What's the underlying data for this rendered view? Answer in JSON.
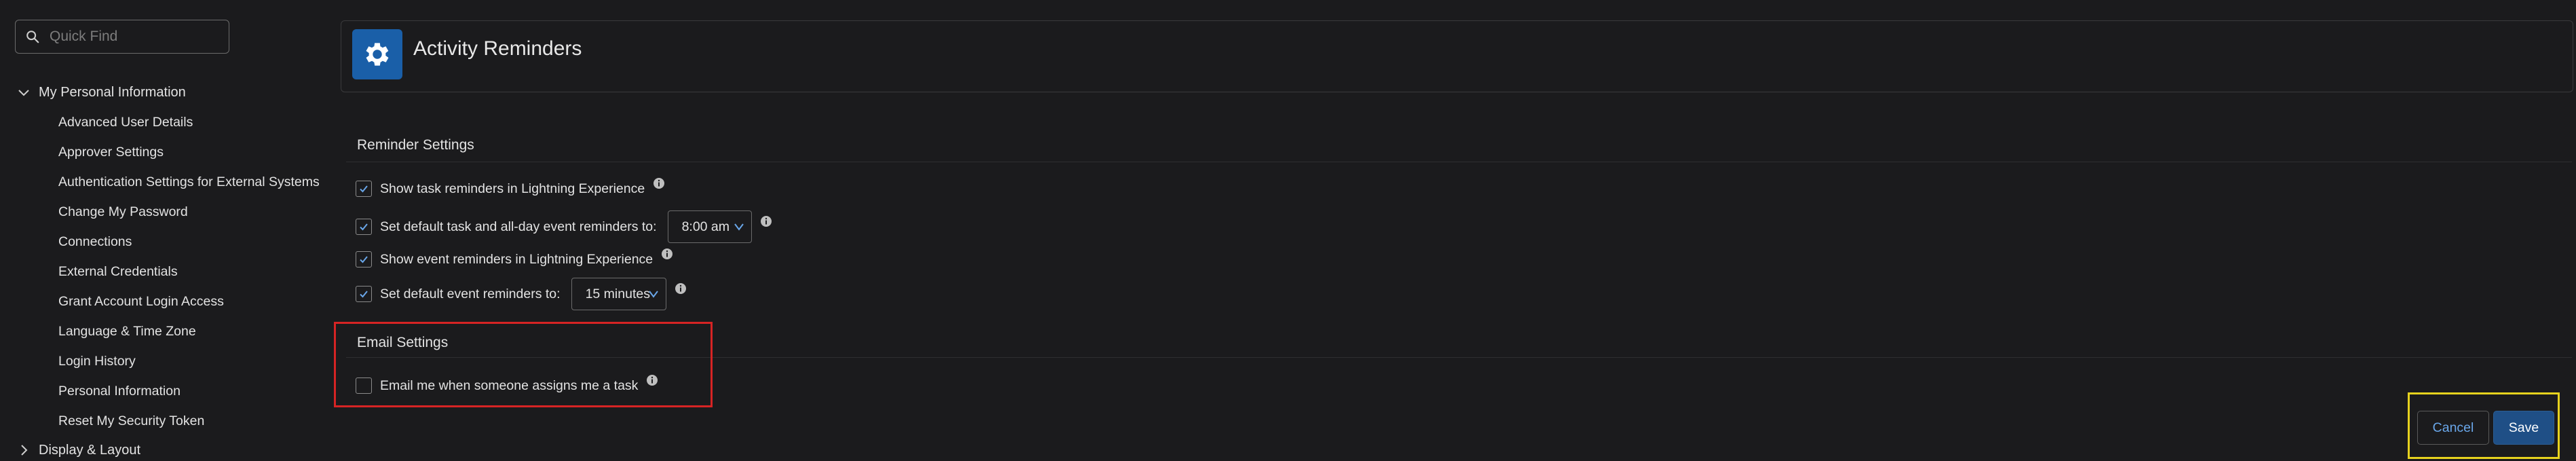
{
  "search": {
    "placeholder": "Quick Find"
  },
  "sidebar": {
    "section_label": "My Personal Information",
    "items": [
      {
        "label": "Advanced User Details"
      },
      {
        "label": "Approver Settings"
      },
      {
        "label": "Authentication Settings for External Systems"
      },
      {
        "label": "Change My Password"
      },
      {
        "label": "Connections"
      },
      {
        "label": "External Credentials"
      },
      {
        "label": "Grant Account Login Access"
      },
      {
        "label": "Language & Time Zone"
      },
      {
        "label": "Login History"
      },
      {
        "label": "Personal Information"
      },
      {
        "label": "Reset My Security Token"
      }
    ],
    "next_section_label": "Display & Layout"
  },
  "page": {
    "title": "Activity Reminders"
  },
  "reminder_settings": {
    "title": "Reminder Settings",
    "rows": [
      {
        "label": "Show task reminders in Lightning Experience",
        "checked": true
      },
      {
        "label": "Set default task and all-day event reminders to:",
        "checked": true,
        "select_value": "8:00 am"
      },
      {
        "label": "Show event reminders in Lightning Experience",
        "checked": true
      },
      {
        "label": "Set default event reminders to:",
        "checked": true,
        "select_value": "15 minutes"
      }
    ]
  },
  "email_settings": {
    "title": "Email Settings",
    "rows": [
      {
        "label": "Email me when someone assigns me a task",
        "checked": false
      }
    ]
  },
  "actions": {
    "cancel_label": "Cancel",
    "save_label": "Save"
  },
  "colors": {
    "accent": "#1a5fa8",
    "highlight_red": "#d62424",
    "highlight_yellow": "#e6d21e",
    "background": "#1b1b1d"
  }
}
